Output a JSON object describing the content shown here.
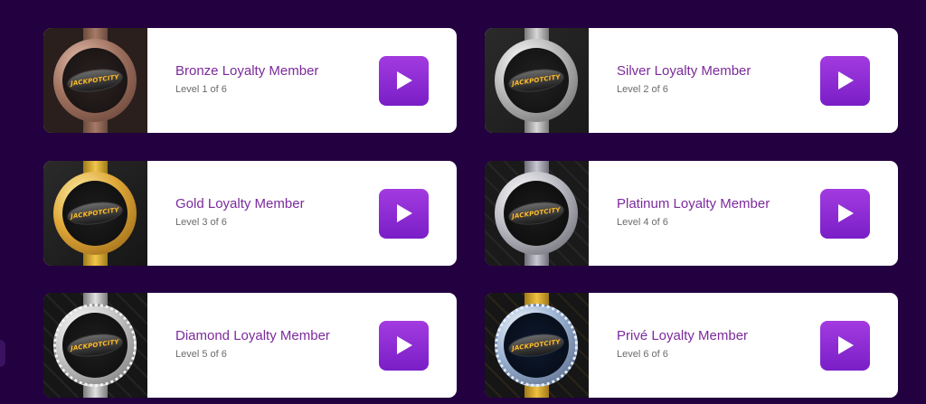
{
  "cards": [
    {
      "title": "Bronze Loyalty Member",
      "level": "Level 1 of 6",
      "badge_text": "JACKPOTCITY",
      "tier": "bronze"
    },
    {
      "title": "Silver Loyalty Member",
      "level": "Level 2 of 6",
      "badge_text": "JACKPOTCITY",
      "tier": "silver"
    },
    {
      "title": "Gold Loyalty Member",
      "level": "Level 3 of 6",
      "badge_text": "JACKPOTCITY",
      "tier": "gold"
    },
    {
      "title": "Platinum Loyalty Member",
      "level": "Level 4 of 6",
      "badge_text": "JACKPOTCITY",
      "tier": "platinum"
    },
    {
      "title": "Diamond Loyalty Member",
      "level": "Level 5 of 6",
      "badge_text": "JACKPOTCITY",
      "tier": "diamond"
    },
    {
      "title": "Privé Loyalty Member",
      "level": "Level 6 of 6",
      "badge_text": "JACKPOTCITY",
      "tier": "prive"
    }
  ],
  "colors": {
    "page_background": "#23003f",
    "title": "#7b2a9c",
    "play_button": "#8b2bd5"
  },
  "icons": {
    "play": "play-icon"
  }
}
